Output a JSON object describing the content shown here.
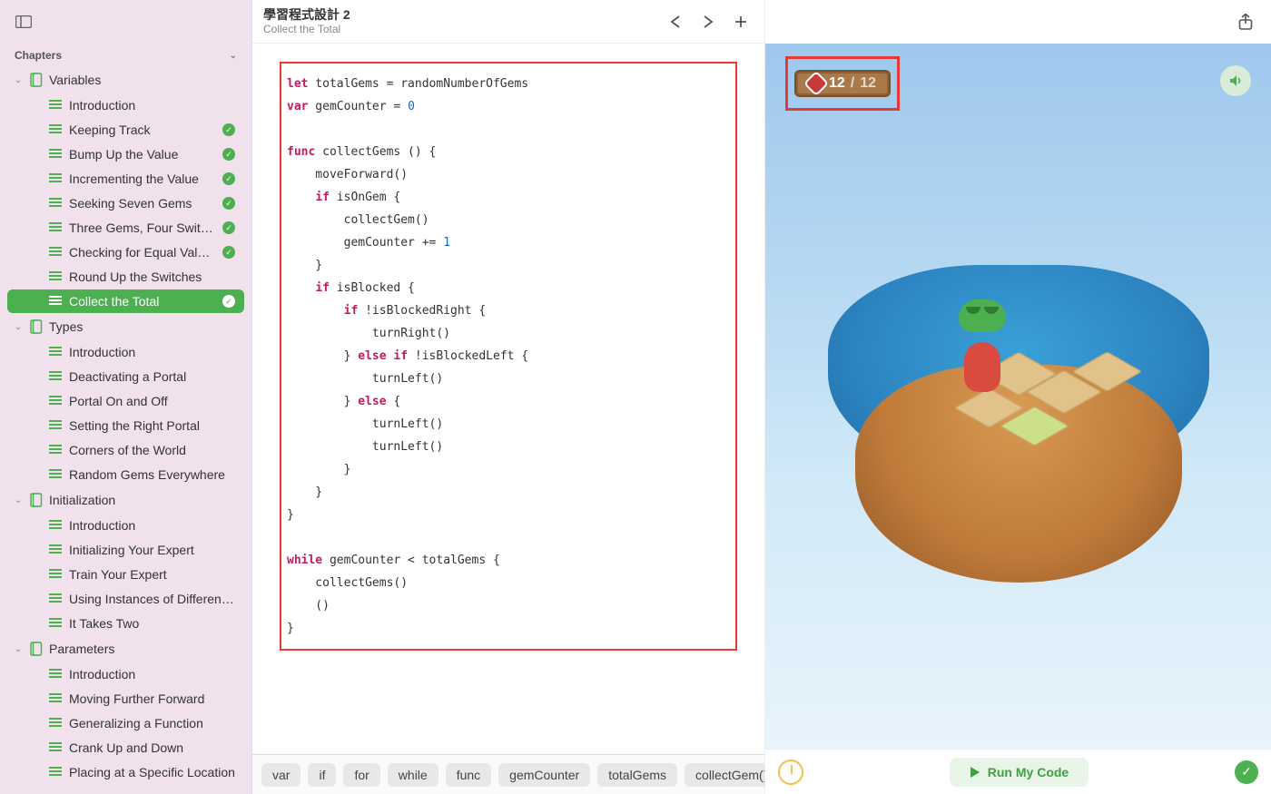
{
  "header": {
    "title": "學習程式設計 2",
    "subtitle": "Collect the Total"
  },
  "sidebar": {
    "heading": "Chapters",
    "sections": [
      {
        "title": "Variables",
        "items": [
          {
            "label": "Introduction",
            "done": false
          },
          {
            "label": "Keeping Track",
            "done": true
          },
          {
            "label": "Bump Up the Value",
            "done": true
          },
          {
            "label": "Incrementing the Value",
            "done": true
          },
          {
            "label": "Seeking Seven Gems",
            "done": true
          },
          {
            "label": "Three Gems, Four Switches",
            "done": true
          },
          {
            "label": "Checking for Equal Values",
            "done": true
          },
          {
            "label": "Round Up the Switches",
            "done": false
          },
          {
            "label": "Collect the Total",
            "done": true,
            "active": true
          }
        ]
      },
      {
        "title": "Types",
        "items": [
          {
            "label": "Introduction"
          },
          {
            "label": "Deactivating a Portal"
          },
          {
            "label": "Portal On and Off"
          },
          {
            "label": "Setting the Right Portal"
          },
          {
            "label": "Corners of the World"
          },
          {
            "label": "Random Gems Everywhere"
          }
        ]
      },
      {
        "title": "Initialization",
        "items": [
          {
            "label": "Introduction"
          },
          {
            "label": "Initializing Your Expert"
          },
          {
            "label": "Train Your Expert"
          },
          {
            "label": "Using Instances of Different Ty…"
          },
          {
            "label": "It Takes Two"
          }
        ]
      },
      {
        "title": "Parameters",
        "items": [
          {
            "label": "Introduction"
          },
          {
            "label": "Moving Further Forward"
          },
          {
            "label": "Generalizing a Function"
          },
          {
            "label": "Crank Up and Down"
          },
          {
            "label": "Placing at a Specific Location"
          }
        ]
      }
    ]
  },
  "code": {
    "lines": [
      [
        [
          "kw",
          "let"
        ],
        [
          "",
          " totalGems = randomNumberOfGems"
        ]
      ],
      [
        [
          "kw",
          "var"
        ],
        [
          "",
          " gemCounter = "
        ],
        [
          "num",
          "0"
        ]
      ],
      [],
      [
        [
          "kw",
          "func"
        ],
        [
          "",
          " collectGems () {"
        ]
      ],
      [
        [
          "",
          "    moveForward()"
        ]
      ],
      [
        [
          "",
          "    "
        ],
        [
          "kw",
          "if"
        ],
        [
          "",
          " isOnGem {"
        ]
      ],
      [
        [
          "",
          "        collectGem()"
        ]
      ],
      [
        [
          "",
          "        gemCounter += "
        ],
        [
          "num",
          "1"
        ]
      ],
      [
        [
          "",
          "    }"
        ]
      ],
      [
        [
          "",
          "    "
        ],
        [
          "kw",
          "if"
        ],
        [
          "",
          " isBlocked {"
        ]
      ],
      [
        [
          "",
          "        "
        ],
        [
          "kw",
          "if"
        ],
        [
          "",
          " !isBlockedRight {"
        ]
      ],
      [
        [
          "",
          "            turnRight()"
        ]
      ],
      [
        [
          "",
          "        } "
        ],
        [
          "kw",
          "else if"
        ],
        [
          "",
          " !isBlockedLeft {"
        ]
      ],
      [
        [
          "",
          "            turnLeft()"
        ]
      ],
      [
        [
          "",
          "        } "
        ],
        [
          "kw",
          "else"
        ],
        [
          "",
          " {"
        ]
      ],
      [
        [
          "",
          "            turnLeft()"
        ]
      ],
      [
        [
          "",
          "            turnLeft()"
        ]
      ],
      [
        [
          "",
          "        }"
        ]
      ],
      [
        [
          "",
          "    }"
        ]
      ],
      [
        [
          "",
          "}"
        ]
      ],
      [],
      [
        [
          "kw",
          "while"
        ],
        [
          "",
          " gemCounter < totalGems {"
        ]
      ],
      [
        [
          "",
          "    collectGems()"
        ]
      ],
      [
        [
          "",
          "    ()"
        ]
      ],
      [
        [
          "",
          "}"
        ]
      ]
    ]
  },
  "chips": [
    "var",
    "if",
    "for",
    "while",
    "func",
    "gemCounter",
    "totalGems",
    "collectGem()"
  ],
  "scene": {
    "score_current": "12",
    "score_sep": "/",
    "score_total": "12"
  },
  "run": {
    "label": "Run My Code"
  }
}
